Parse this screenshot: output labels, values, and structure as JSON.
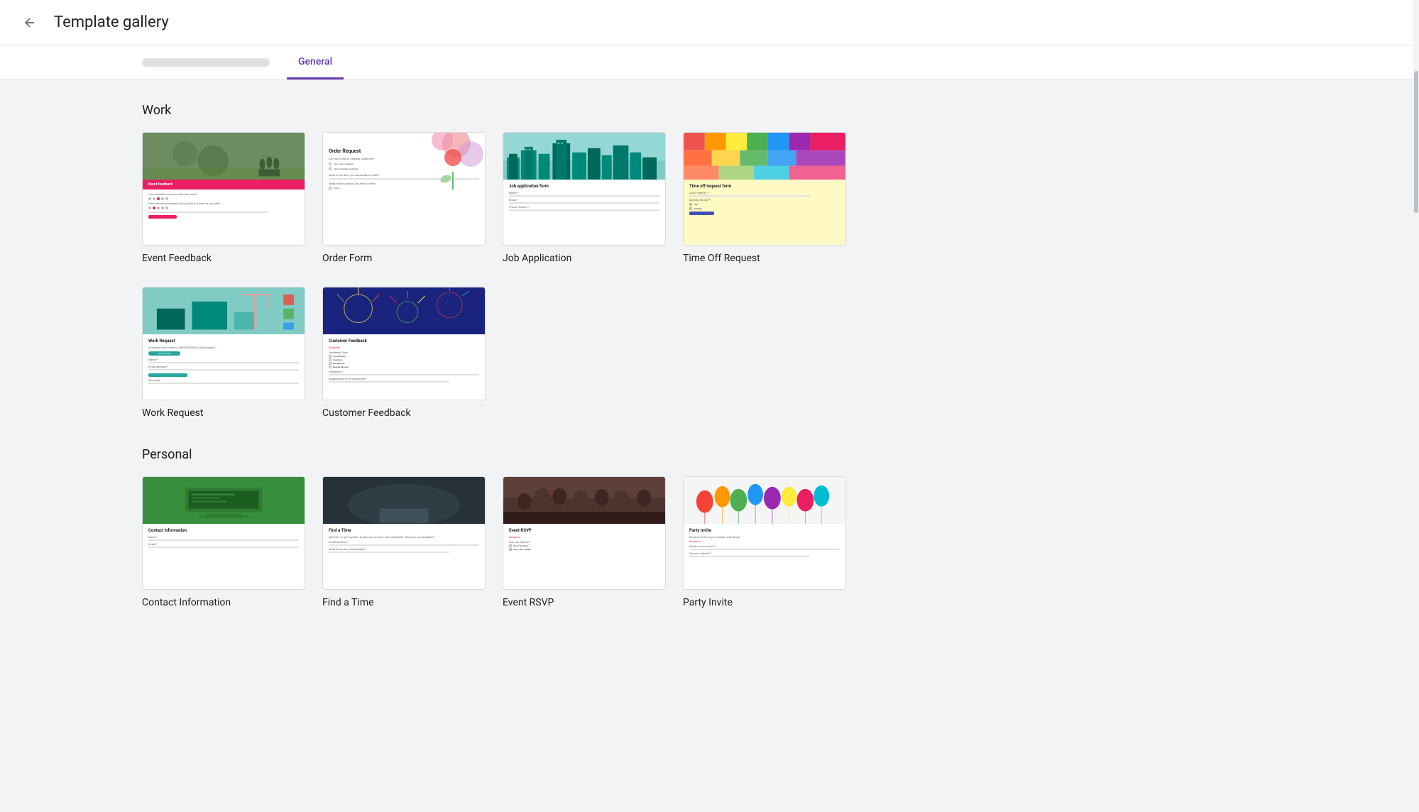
{
  "header": {
    "back_label": "←",
    "title": "Template gallery"
  },
  "tabs": {
    "blurred_placeholder": "blurred tab",
    "active": "General"
  },
  "sections": [
    {
      "id": "work",
      "title": "Work",
      "templates": [
        {
          "id": "event-feedback",
          "name": "Event Feedback",
          "thumb_type": "event-feedback"
        },
        {
          "id": "order-form",
          "name": "Order Form",
          "thumb_type": "order-form"
        },
        {
          "id": "job-application",
          "name": "Job Application",
          "thumb_type": "job-application"
        },
        {
          "id": "time-off-request",
          "name": "Time Off Request",
          "thumb_type": "time-off"
        },
        {
          "id": "work-request",
          "name": "Work Request",
          "thumb_type": "work-request"
        },
        {
          "id": "customer-feedback",
          "name": "Customer Feedback",
          "thumb_type": "customer-feedback"
        }
      ]
    },
    {
      "id": "personal",
      "title": "Personal",
      "templates": [
        {
          "id": "contact-info",
          "name": "Contact Information",
          "thumb_type": "contact-info"
        },
        {
          "id": "find-time",
          "name": "Find a Time",
          "thumb_type": "find-time"
        },
        {
          "id": "event-rsvp",
          "name": "Event RSVP",
          "thumb_type": "event-rsvp"
        },
        {
          "id": "party-invite",
          "name": "Party Invite",
          "thumb_type": "party-invite"
        }
      ]
    }
  ]
}
